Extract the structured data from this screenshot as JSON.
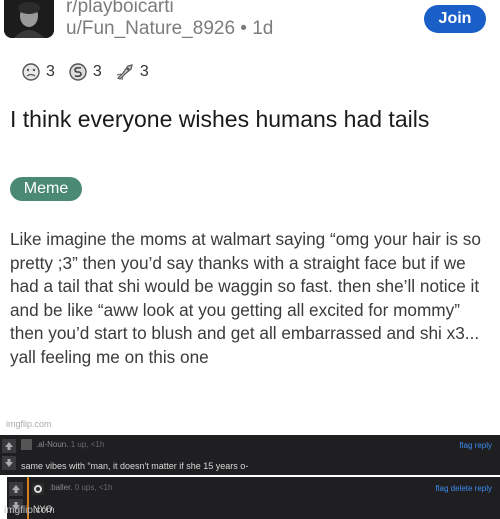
{
  "post": {
    "subreddit": "r/playboicarti",
    "author": "u/Fun_Nature_8926",
    "age": "1d",
    "join_label": "Join",
    "awards": [
      {
        "icon": "sad-face-award-icon",
        "count": "3"
      },
      {
        "icon": "snoo-coin-award-icon",
        "count": "3"
      },
      {
        "icon": "rocket-award-icon",
        "count": "3"
      }
    ],
    "title": "I think everyone wishes humans had tails",
    "flair": "Meme",
    "body": "Like imagine the moms at walmart saying “omg your hair is so pretty ;3” then you’d say thanks with a straight face but if we had a tail that shi would be waggin so fast. then she’ll notice it and be like “aww look at you getting all excited for mommy” then you’d start to blush and get all embarrassed and shi x3... yall feeling me on this one"
  },
  "watermark": "imgflip.com",
  "comments": [
    {
      "username": ".al-Noun.",
      "meta": "1 up, <1h",
      "links": "flag reply",
      "text": "same vibes with “man, it doesn't matter if she 15 years o-"
    },
    {
      "username": ".baller.",
      "meta": "0 ups, <1h",
      "links": "flag delete reply",
      "text": "NYO"
    }
  ]
}
